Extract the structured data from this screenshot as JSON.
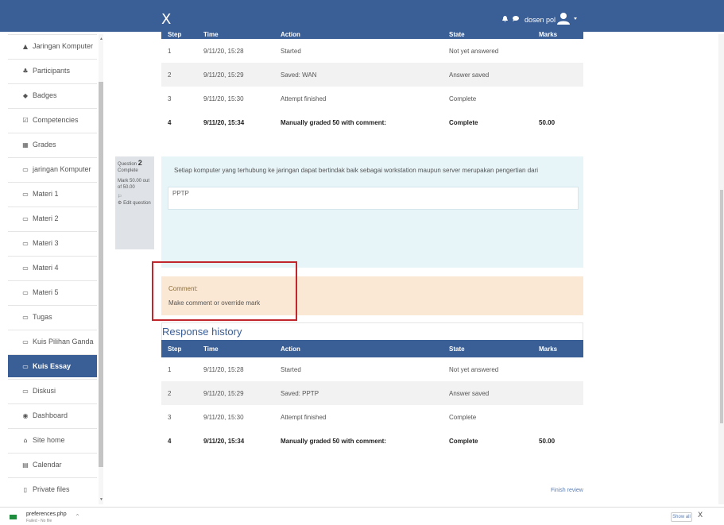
{
  "header": {
    "close_symbol": "X",
    "username": "dosen pol",
    "icons": [
      "bell-icon",
      "chat-icon",
      "user-avatar-icon",
      "caret-down-icon"
    ],
    "color": "#3a5e96"
  },
  "sidebar": {
    "items": [
      {
        "icon": "graduation-cap-icon",
        "glyph": "▲",
        "label": "Jaringan Komputer"
      },
      {
        "icon": "users-icon",
        "glyph": "♣",
        "label": "Participants"
      },
      {
        "icon": "shield-icon",
        "glyph": "◆",
        "label": "Badges"
      },
      {
        "icon": "checkbox-icon",
        "glyph": "☑",
        "label": "Competencies"
      },
      {
        "icon": "table-icon",
        "glyph": "▦",
        "label": "Grades"
      },
      {
        "icon": "folder-icon",
        "glyph": "▭",
        "label": "jaringan Komputer"
      },
      {
        "icon": "folder-icon",
        "glyph": "▭",
        "label": "Materi 1"
      },
      {
        "icon": "folder-icon",
        "glyph": "▭",
        "label": "Materi 2"
      },
      {
        "icon": "folder-icon",
        "glyph": "▭",
        "label": "Materi 3"
      },
      {
        "icon": "folder-icon",
        "glyph": "▭",
        "label": "Materi 4"
      },
      {
        "icon": "folder-icon",
        "glyph": "▭",
        "label": "Materi 5"
      },
      {
        "icon": "folder-icon",
        "glyph": "▭",
        "label": "Tugas"
      },
      {
        "icon": "folder-icon",
        "glyph": "▭",
        "label": "Kuis Pilihan Ganda"
      },
      {
        "icon": "folder-icon",
        "glyph": "▭",
        "label": "Kuis Essay",
        "active": true
      },
      {
        "icon": "folder-icon",
        "glyph": "▭",
        "label": "Diskusi"
      },
      {
        "icon": "dashboard-icon",
        "glyph": "◉",
        "label": "Dashboard"
      },
      {
        "icon": "home-icon",
        "glyph": "⌂",
        "label": "Site home"
      },
      {
        "icon": "calendar-icon",
        "glyph": "▤",
        "label": "Calendar"
      },
      {
        "icon": "file-icon",
        "glyph": "▯",
        "label": "Private files"
      }
    ]
  },
  "top_history": {
    "headers": [
      "Step",
      "Time",
      "Action",
      "State",
      "Marks"
    ],
    "rows": [
      [
        "1",
        "9/11/20, 15:28",
        "Started",
        "Not yet answered",
        ""
      ],
      [
        "2",
        "9/11/20, 15:29",
        "Saved: WAN",
        "Answer saved",
        ""
      ],
      [
        "3",
        "9/11/20, 15:30",
        "Attempt finished",
        "Complete",
        ""
      ],
      [
        "4",
        "9/11/20, 15:34",
        "Manually graded 50 with comment:",
        "Complete",
        "50.00"
      ]
    ]
  },
  "question": {
    "label": "Question",
    "number": "2",
    "status": "Complete",
    "mark": "Mark 50.00 out of 50.00",
    "flag": "⚐",
    "edit": "Edit question",
    "text": "Setiap komputer yang terhubung ke jaringan dapat bertindak baik sebagai workstation maupun server merupakan pengertian dari",
    "answer": "PPTP"
  },
  "comment": {
    "label": "Comment:",
    "link": "Make comment or override mark"
  },
  "response_history": {
    "title": "Response history",
    "headers": [
      "Step",
      "Time",
      "Action",
      "State",
      "Marks"
    ],
    "rows": [
      [
        "1",
        "9/11/20, 15:28",
        "Started",
        "Not yet answered",
        ""
      ],
      [
        "2",
        "9/11/20, 15:29",
        "Saved: PPTP",
        "Answer saved",
        ""
      ],
      [
        "3",
        "9/11/20, 15:30",
        "Attempt finished",
        "Complete",
        ""
      ],
      [
        "4",
        "9/11/20, 15:34",
        "Manually graded 50 with comment:",
        "Complete",
        "50.00"
      ]
    ]
  },
  "finish_review": "Finish review",
  "download_bar": {
    "file": "preferences.php",
    "sub": "Failed - No file",
    "show_all": "Show all",
    "close": "X"
  }
}
